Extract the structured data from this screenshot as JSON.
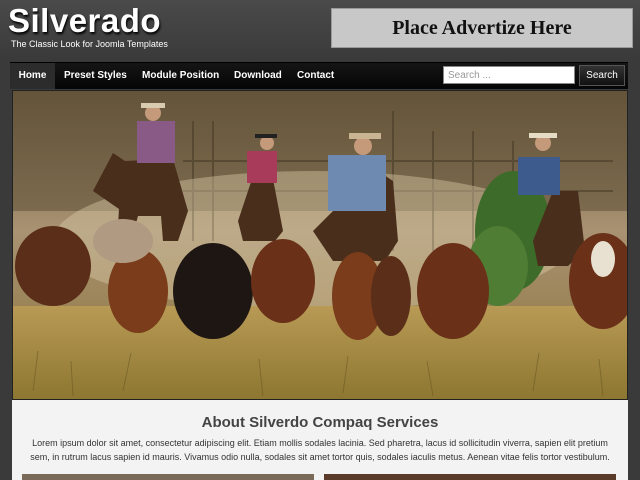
{
  "site": {
    "title": "Silverado",
    "tagline": "The Classic Look for Joomla Templates"
  },
  "ad": {
    "text": "Place Advertize Here"
  },
  "nav": {
    "items": [
      {
        "label": "Home",
        "active": true
      },
      {
        "label": "Preset Styles",
        "active": false
      },
      {
        "label": "Module Position",
        "active": false
      },
      {
        "label": "Download",
        "active": false
      },
      {
        "label": "Contact",
        "active": false
      }
    ]
  },
  "search": {
    "placeholder": "Search ...",
    "button_label": "Search"
  },
  "about": {
    "title": "About Silverdo Compaq Services",
    "body": "Lorem ipsum dolor sit amet, consectetur adipiscing elit. Etiam mollis sodales lacinia. Sed pharetra, lacus id sollicitudin viverra, sapien elit pretium sem, in rutrum lacus sapien id mauris. Vivamus odio nulla, sodales sit amet tortor quis, sodales iaculis metus. Aenean vitae felis tortor vestibulum."
  },
  "colors": {
    "background": "#3a3a3a",
    "navbar": "#0a0a0a",
    "ad_banner": "#c8c8c8",
    "about_panel": "#f3f3f3"
  }
}
